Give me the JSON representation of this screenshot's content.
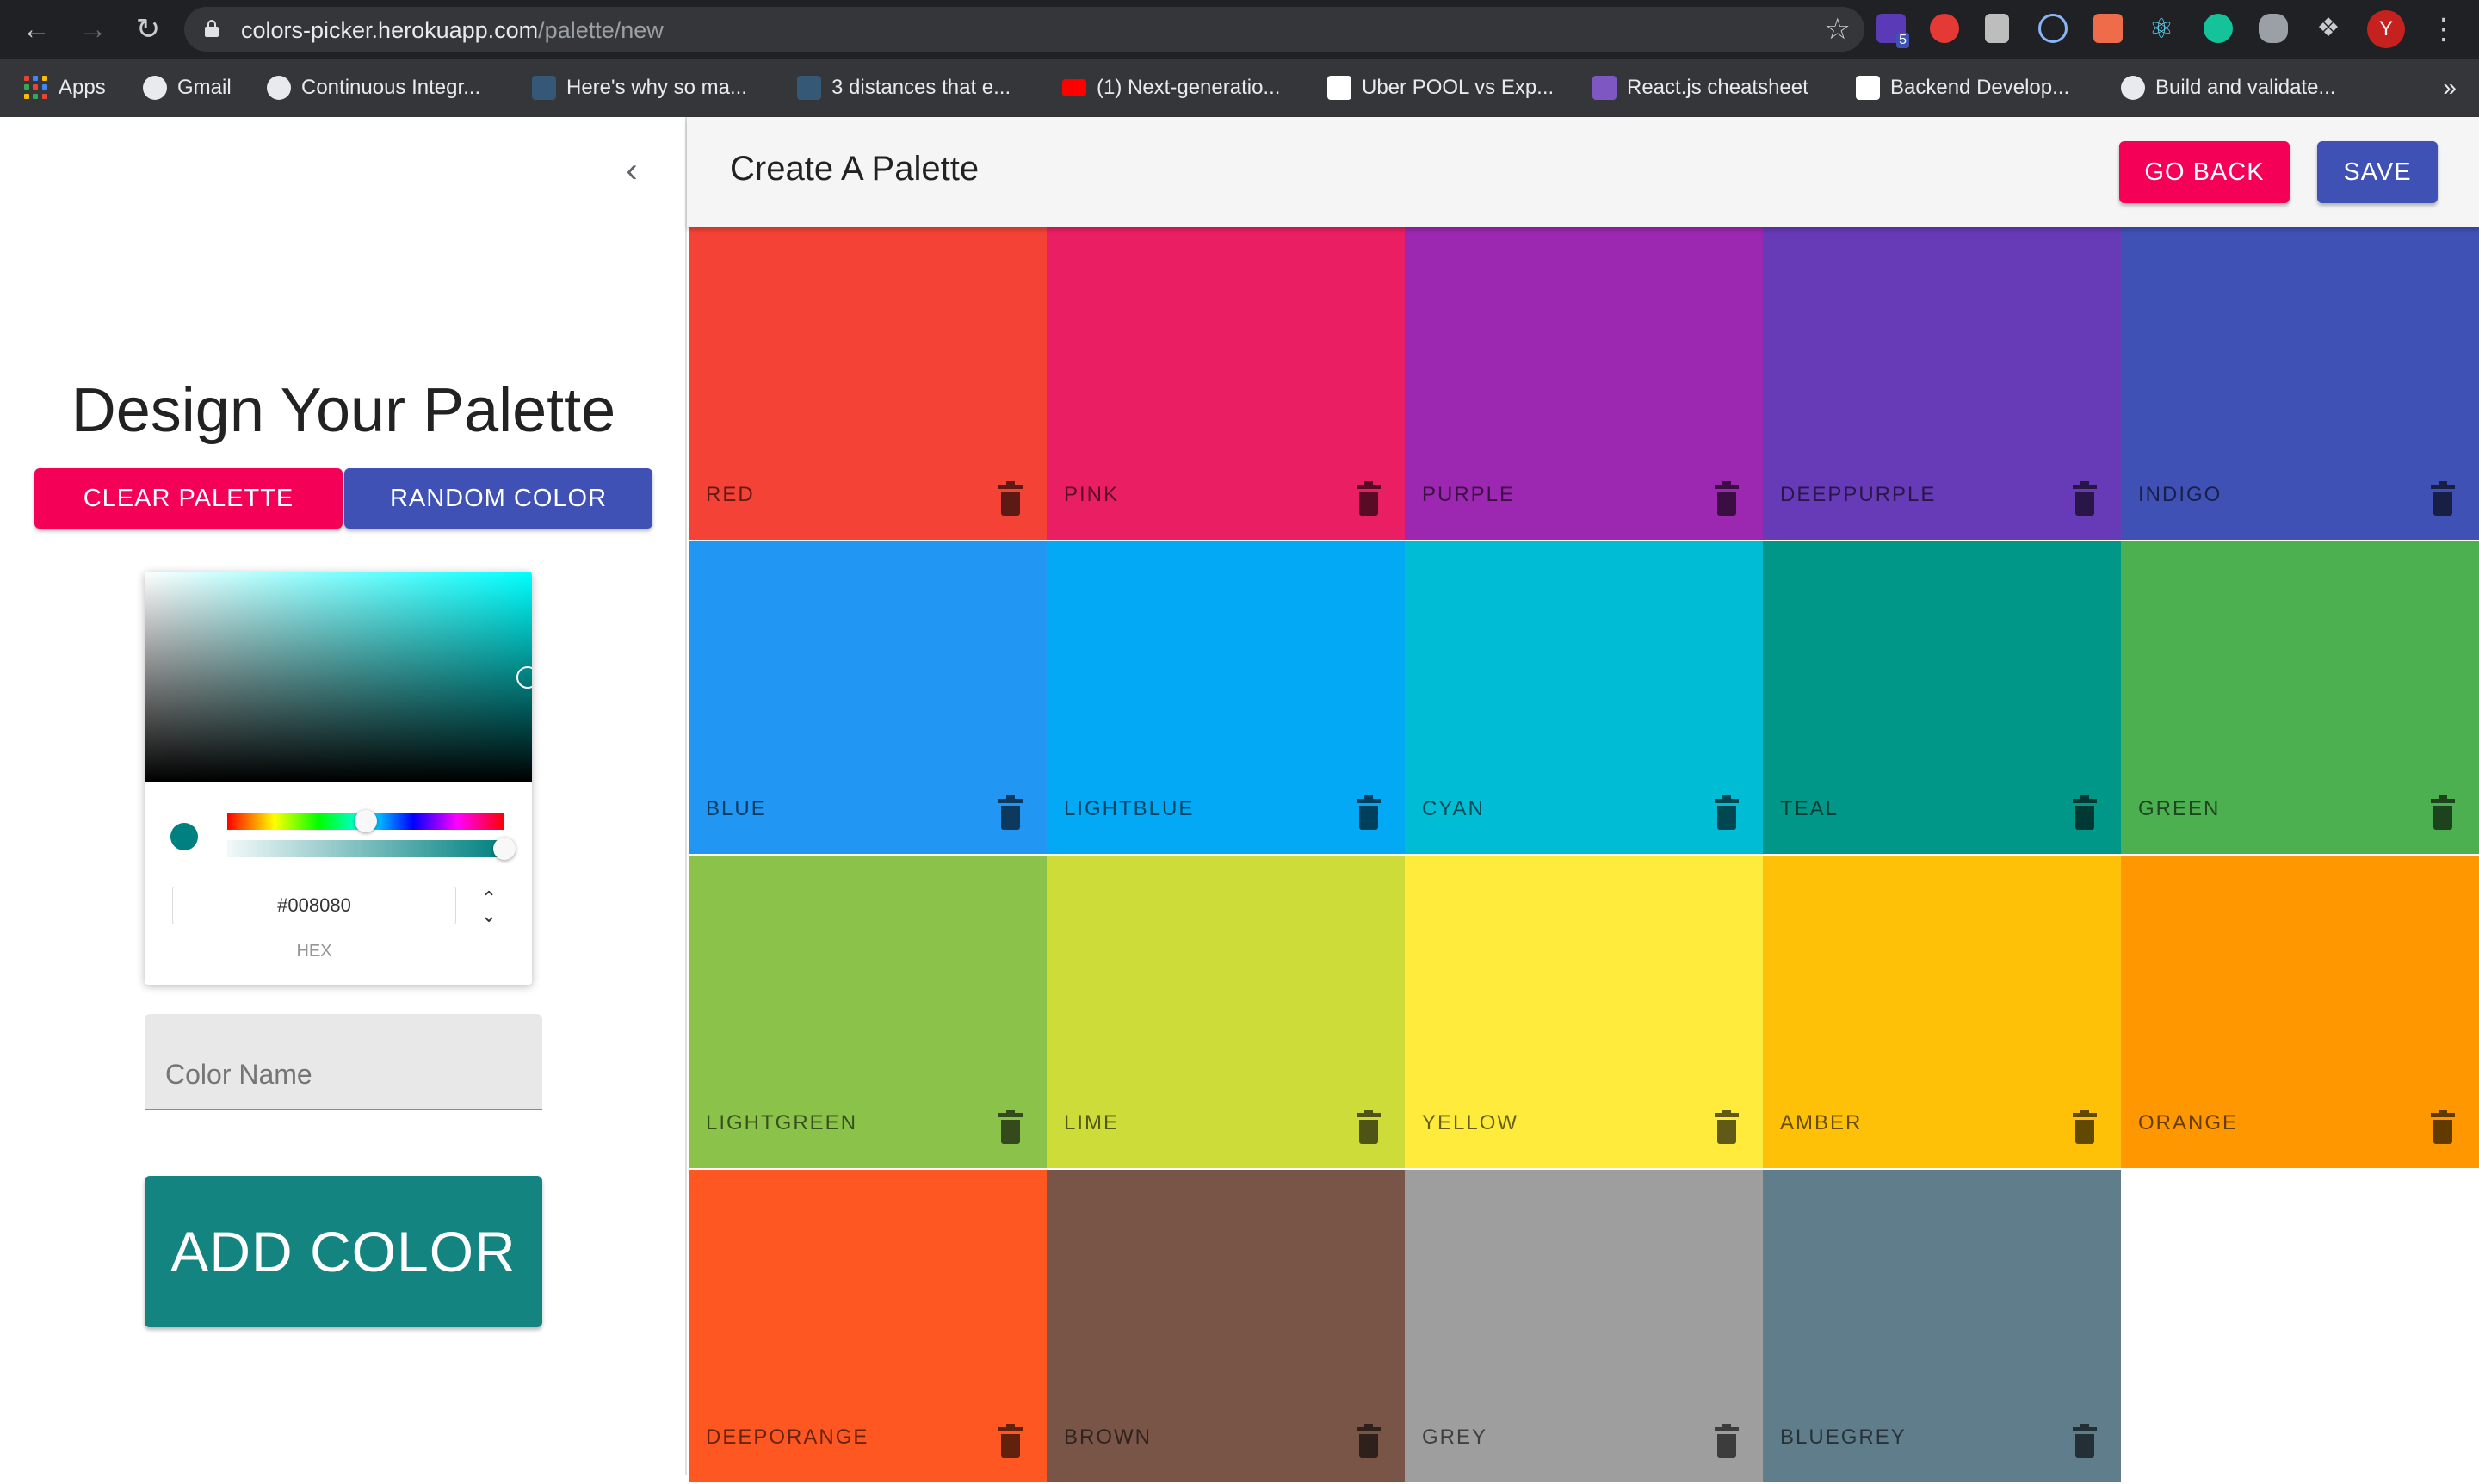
{
  "browser": {
    "url_host": "colors-picker.herokuapp.com",
    "url_path": "/palette/new",
    "avatar_initial": "Y",
    "extension_badge": "5",
    "bookmarks": [
      {
        "label": "Apps",
        "icon": "apps-grid-icon"
      },
      {
        "label": "Gmail",
        "icon": "globe-icon"
      },
      {
        "label": "Continuous Integr...",
        "icon": "globe-icon"
      },
      {
        "label": "Here's why so ma...",
        "icon": "tds-icon"
      },
      {
        "label": "3 distances that e...",
        "icon": "tds-icon"
      },
      {
        "label": "(1) Next-generatio...",
        "icon": "youtube-icon"
      },
      {
        "label": "Uber POOL vs Exp...",
        "icon": "r-logo-icon"
      },
      {
        "label": "React.js cheatsheet",
        "icon": "bookmark-purple-icon"
      },
      {
        "label": "Backend Develop...",
        "icon": "r-dot-icon"
      },
      {
        "label": "Build and validate...",
        "icon": "globe-icon"
      }
    ],
    "more_bookmarks": "»"
  },
  "drawer": {
    "title": "Design Your Palette",
    "clear_label": "CLEAR PALETTE",
    "random_label": "RANDOM COLOR",
    "picker": {
      "hex_value": "#008080",
      "hex_label": "HEX",
      "current_color": "#008080",
      "hue_fraction": 0.5,
      "alpha_fraction": 1.0
    },
    "name_placeholder": "Color Name",
    "add_label": "ADD COLOR"
  },
  "appbar": {
    "title": "Create A Palette",
    "back_label": "GO BACK",
    "save_label": "SAVE"
  },
  "colors": [
    {
      "name": "RED",
      "hex": "#f44336"
    },
    {
      "name": "PINK",
      "hex": "#e91e63"
    },
    {
      "name": "PURPLE",
      "hex": "#9c27b0"
    },
    {
      "name": "DEEPPURPLE",
      "hex": "#673ab7"
    },
    {
      "name": "INDIGO",
      "hex": "#3f51b5"
    },
    {
      "name": "BLUE",
      "hex": "#2196f3"
    },
    {
      "name": "LIGHTBLUE",
      "hex": "#03a9f4"
    },
    {
      "name": "CYAN",
      "hex": "#00bcd4"
    },
    {
      "name": "TEAL",
      "hex": "#009688"
    },
    {
      "name": "GREEN",
      "hex": "#4caf50"
    },
    {
      "name": "LIGHTGREEN",
      "hex": "#8bc34a"
    },
    {
      "name": "LIME",
      "hex": "#cddc39"
    },
    {
      "name": "YELLOW",
      "hex": "#ffeb3b"
    },
    {
      "name": "AMBER",
      "hex": "#ffc107"
    },
    {
      "name": "ORANGE",
      "hex": "#ff9800"
    },
    {
      "name": "DEEPORANGE",
      "hex": "#ff5722"
    },
    {
      "name": "BROWN",
      "hex": "#795548"
    },
    {
      "name": "GREY",
      "hex": "#9e9e9e"
    },
    {
      "name": "BLUEGREY",
      "hex": "#607d8b"
    }
  ]
}
